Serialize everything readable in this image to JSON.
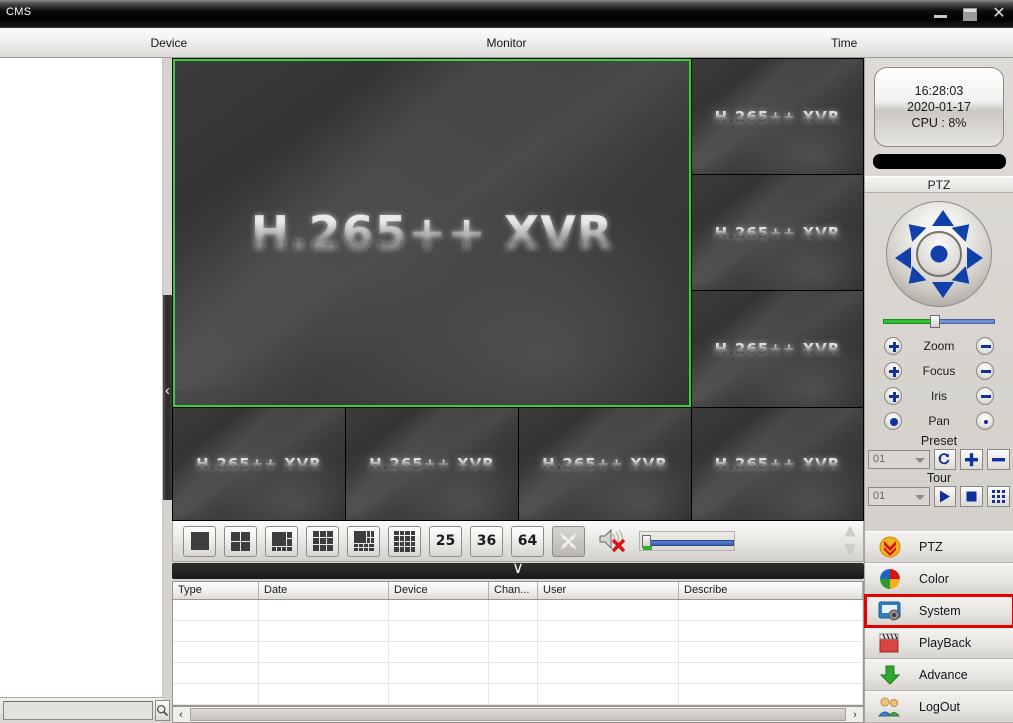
{
  "window": {
    "title": "CMS",
    "controls": {
      "minimize": "minimize-button",
      "maximize": "maximize-button",
      "close": "close-button"
    }
  },
  "tabs": [
    {
      "label": "Device",
      "name": "tab-device"
    },
    {
      "label": "Monitor",
      "name": "tab-monitor"
    },
    {
      "label": "Time",
      "name": "tab-time"
    }
  ],
  "device_panel": {
    "search_placeholder": "",
    "search_value": "",
    "search_button": "search-icon",
    "refresh_button": "refresh-icon",
    "collapse_handle": "‹"
  },
  "video": {
    "logo_text": "H.265++  XVR",
    "logo_text_small": "H.265++ XVR",
    "selected_pane_index": 0,
    "selection_color": "#35d235",
    "panes": [
      {
        "label": "H.265++  XVR",
        "selected": true
      },
      {
        "label": "H.265++ XVR",
        "selected": false
      },
      {
        "label": "H.265++ XVR",
        "selected": false
      },
      {
        "label": "H.265++ XVR",
        "selected": false
      },
      {
        "label": "H.265++ XVR",
        "selected": false
      },
      {
        "label": "H.265++ XVR",
        "selected": false
      },
      {
        "label": "H.265++ XVR",
        "selected": false
      },
      {
        "label": "H.265++ XVR",
        "selected": false
      }
    ]
  },
  "toolbar": {
    "split_1": "1-split-layout",
    "split_4": "4-split-layout",
    "split_6": "6-split-layout",
    "split_9": "9-split-layout",
    "split_8": "8-split-layout",
    "split_16": "16-split-layout",
    "split_25_label": "25",
    "split_36_label": "36",
    "split_64_label": "64",
    "fullscreen": "fullscreen-icon",
    "mute": "speaker-muted-icon",
    "volume_value": 4,
    "scroll_up": "▲",
    "scroll_down": "▼"
  },
  "splitter": {
    "chevron": "∨"
  },
  "log": {
    "columns": [
      "Type",
      "Date",
      "Device",
      "Chan...",
      "User",
      "Describe"
    ],
    "rows": [],
    "scroll_left": "‹",
    "scroll_right": "›"
  },
  "status": {
    "time": "16:28:03",
    "date": "2020-01-17",
    "cpu": "CPU : 8%"
  },
  "ptz": {
    "header": "PTZ",
    "speed_value": 46,
    "controls": [
      {
        "label": "Zoom",
        "inc": "+",
        "dec": "−"
      },
      {
        "label": "Focus",
        "inc": "+",
        "dec": "−"
      },
      {
        "label": "Iris",
        "inc": "+",
        "dec": "−"
      },
      {
        "label": "Pan",
        "inc": "●",
        "dec": "·"
      }
    ],
    "preset": {
      "label": "Preset",
      "value": "01",
      "goto": "preset-call-icon",
      "add": "+",
      "remove": "−"
    },
    "tour": {
      "label": "Tour",
      "value": "01",
      "play": "play-icon",
      "stop": "stop-icon",
      "setup": "grid-icon"
    }
  },
  "menu": {
    "active": "System",
    "highlight_color": "#e60000",
    "items": [
      {
        "label": "PTZ",
        "icon": "ptz-icon"
      },
      {
        "label": "Color",
        "icon": "color-wheel-icon"
      },
      {
        "label": "System",
        "icon": "system-icon"
      },
      {
        "label": "PlayBack",
        "icon": "clapperboard-icon"
      },
      {
        "label": "Advance",
        "icon": "down-arrow-icon"
      },
      {
        "label": "LogOut",
        "icon": "users-icon"
      }
    ]
  }
}
